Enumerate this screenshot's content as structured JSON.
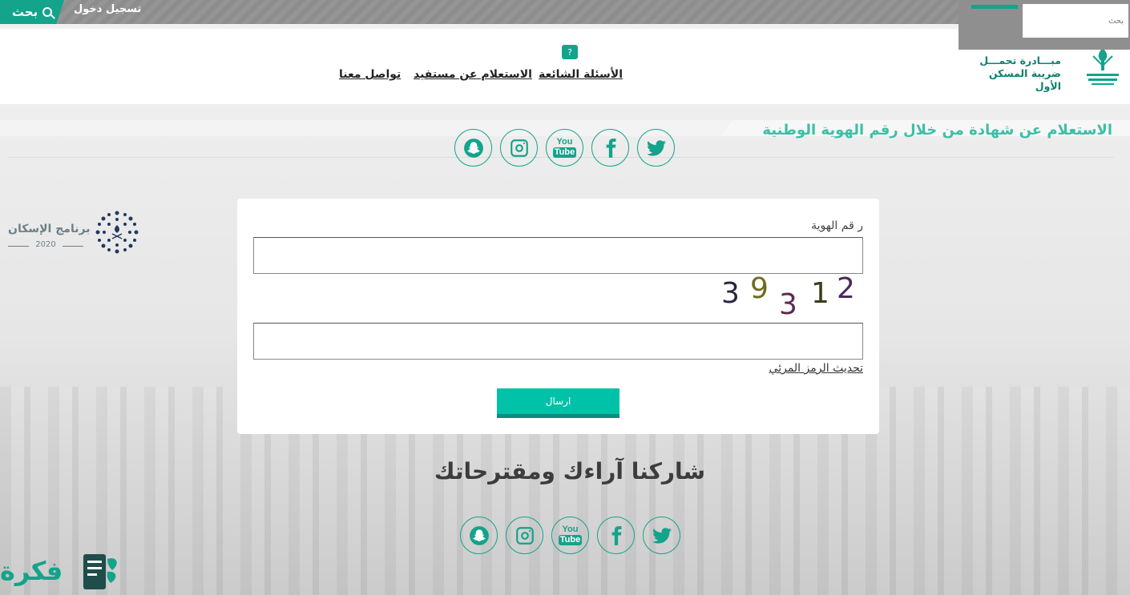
{
  "topbar": {
    "search_label": "بحث",
    "login_label": "تسجيل دخول",
    "search_placeholder": "بحث"
  },
  "header": {
    "initiative_line1": "مبـــادرة تحمـــل",
    "initiative_line2": "ضريبة المسكن الأول",
    "nav": [
      {
        "label": "الأسئلة الشائعة"
      },
      {
        "label": "الاستعلام عن مستفيد"
      },
      {
        "label": "تواصل معنا"
      }
    ]
  },
  "page": {
    "heading": "الاستعلام عن شهادة من خلال رقم الهوية الوطنية"
  },
  "social": {
    "youtube_top": "You",
    "youtube_bottom": "Tube"
  },
  "program": {
    "name": "برنامج الإسكان",
    "year": "2020"
  },
  "form": {
    "id_label": "ر قم الهوية",
    "id_value": "",
    "captcha_value": "",
    "captcha_digits": [
      {
        "char": "3",
        "color": "#2b2640"
      },
      {
        "char": "9",
        "color": "#6f6a1e"
      },
      {
        "char": "3",
        "color": "#5a2a4f"
      },
      {
        "char": "1",
        "color": "#3f3a1a"
      },
      {
        "char": "2",
        "color": "#4a2a5e"
      }
    ],
    "refresh_label": "تحديث الرمز المرئي",
    "submit_label": "ارسال"
  },
  "footer": {
    "share_heading": "شاركنا آراءك ومقترحاتك"
  },
  "watermark": {
    "text": "فكرة"
  },
  "colors": {
    "accent": "#14a38b",
    "heading": "#3dbfa6",
    "button": "#00c2a8"
  }
}
